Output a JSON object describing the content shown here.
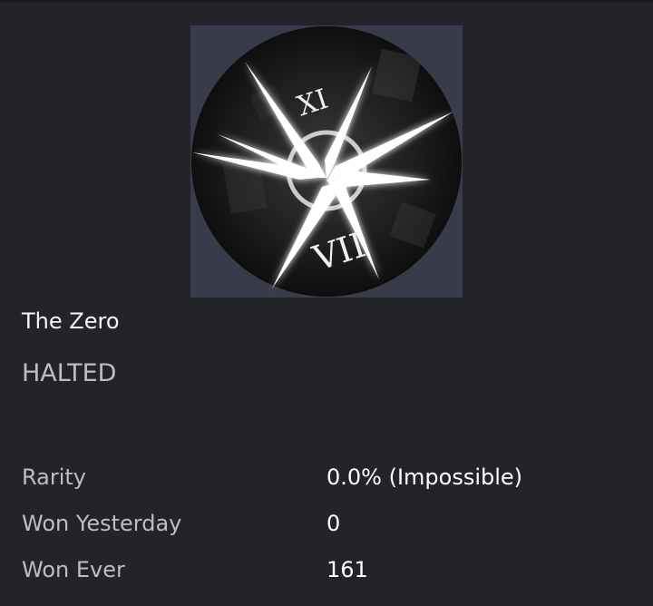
{
  "badge": {
    "name": "The Zero",
    "game": "HALTED",
    "image_icon": "clock-cross-emblem-icon",
    "numerals": [
      "XI",
      "VII"
    ]
  },
  "stats": [
    {
      "label": "Rarity",
      "value": "0.0% (Impossible)"
    },
    {
      "label": "Won Yesterday",
      "value": "0"
    },
    {
      "label": "Won Ever",
      "value": "161"
    }
  ],
  "colors": {
    "background": "#232429",
    "image_frame": "#393b4a",
    "label_text": "#bdbec3",
    "value_text": "#ffffff"
  }
}
